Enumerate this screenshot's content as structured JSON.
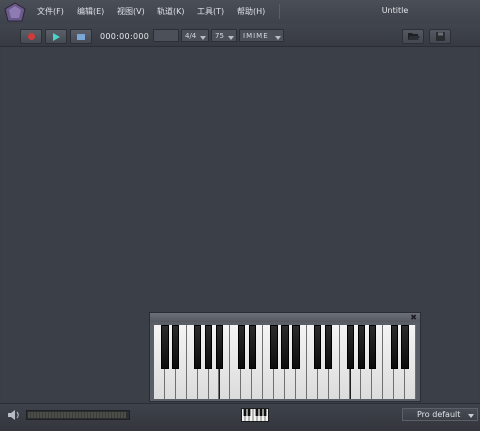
{
  "window": {
    "title": "Untitle"
  },
  "menu": {
    "items": [
      {
        "label": "文件(F)"
      },
      {
        "label": "编辑(E)"
      },
      {
        "label": "视图(V)"
      },
      {
        "label": "轨道(K)"
      },
      {
        "label": "工具(T)"
      },
      {
        "label": "帮助(H)"
      }
    ]
  },
  "toolbar": {
    "timecode": "000:00:000",
    "time_signature": "4/4",
    "tempo": "75",
    "input_mode": "IMIME",
    "icons": {
      "record": "record-icon",
      "play": "play-icon",
      "stop": "stop-icon",
      "open": "folder-open-icon",
      "save": "save-icon"
    },
    "colors": {
      "record": "#d23a3a",
      "play": "#4cd2c8",
      "stop": "#7aa6d8"
    }
  },
  "piano": {
    "close_label": "✖",
    "white_keys": 24,
    "black_key_pattern": [
      1,
      1,
      0,
      1,
      1,
      1,
      0
    ]
  },
  "statusbar": {
    "volume_icon": "speaker-icon",
    "volume_level": 0.98,
    "keyboard_icon": "piano-keyboard-icon",
    "preset": "Pro default"
  }
}
